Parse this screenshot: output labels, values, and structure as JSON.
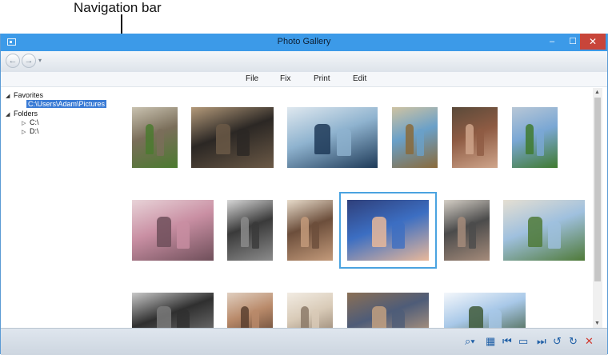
{
  "callout": {
    "label": "Navigation bar"
  },
  "window": {
    "title": "Photo Gallery",
    "buttons": {
      "minimize": "–",
      "maximize": "☐",
      "close": "✕"
    }
  },
  "navbar": {
    "back": "←",
    "forward": "→",
    "dropdown": "▾"
  },
  "menu": {
    "items": [
      "File",
      "Fix",
      "Print",
      "Edit"
    ]
  },
  "tree": {
    "favorites": "Favorites",
    "favorite_path": "C:\\Users\\Adam\\Pictures",
    "folders": "Folders",
    "folder_items": [
      "C:\\",
      "D:\\"
    ],
    "expanded_arrow": "◢",
    "collapsed_arrow": "▷"
  },
  "photos": [
    {
      "subject": "kids-on-bike",
      "colors": [
        "#7a6e5a",
        "#4b7a2f",
        "#c9c2b0"
      ]
    },
    {
      "subject": "group-indoor",
      "colors": [
        "#2b2724",
        "#6b5946",
        "#b49a7a"
      ]
    },
    {
      "subject": "lake-paddle",
      "colors": [
        "#8fb3cf",
        "#1e3a58",
        "#dfe8ef"
      ]
    },
    {
      "subject": "playground",
      "colors": [
        "#6aa0c8",
        "#8a6a3a",
        "#cfc3a2"
      ]
    },
    {
      "subject": "family-table",
      "colors": [
        "#8e5b43",
        "#cfa58b",
        "#5a4a3a"
      ]
    },
    {
      "subject": "boy-field",
      "colors": [
        "#7aa7d4",
        "#3f7a2f",
        "#b8c7d6"
      ]
    },
    {
      "subject": "party-room",
      "colors": [
        "#c98fa3",
        "#6f4f5a",
        "#e8d3d8"
      ]
    },
    {
      "subject": "car-ride",
      "colors": [
        "#3a3a3a",
        "#8b8b8b",
        "#d7d7d7"
      ]
    },
    {
      "subject": "reading-kids",
      "colors": [
        "#6c4e3b",
        "#c39a7a",
        "#e8dccb"
      ]
    },
    {
      "subject": "selfie-family",
      "colors": [
        "#3c6ec2",
        "#e9b89a",
        "#2f3f7a"
      ]
    },
    {
      "subject": "kids-bench",
      "colors": [
        "#4b4b4b",
        "#a58b7a",
        "#d5cfc6"
      ]
    },
    {
      "subject": "outdoor-table",
      "colors": [
        "#9fc0de",
        "#4f7a38",
        "#e5dfd2"
      ]
    },
    {
      "subject": "car-seat",
      "colors": [
        "#2f2f2f",
        "#7a7a7a",
        "#c9c9c9"
      ]
    },
    {
      "subject": "woman-shelves",
      "colors": [
        "#b98a6a",
        "#5a3f2f",
        "#e0cfc0"
      ]
    },
    {
      "subject": "indoor-light",
      "colors": [
        "#d9cbb8",
        "#8c7a68",
        "#f2ece3"
      ]
    },
    {
      "subject": "kids-bench-2",
      "colors": [
        "#4e5c78",
        "#c2a080",
        "#8a6f55"
      ]
    },
    {
      "subject": "snow-trees",
      "colors": [
        "#a8c8e8",
        "#3f5a3a",
        "#f4f7fb"
      ]
    }
  ],
  "toolbar": {
    "icons": [
      "zoom-icon",
      "grid-icon",
      "previous-icon",
      "slideshow-icon",
      "next-icon",
      "rotate-left-icon",
      "rotate-right-icon",
      "delete-icon"
    ],
    "glyphs": [
      "⌕▾",
      "▦",
      "⏮",
      "▭",
      "⏭",
      "↺",
      "↻",
      "✕"
    ]
  }
}
